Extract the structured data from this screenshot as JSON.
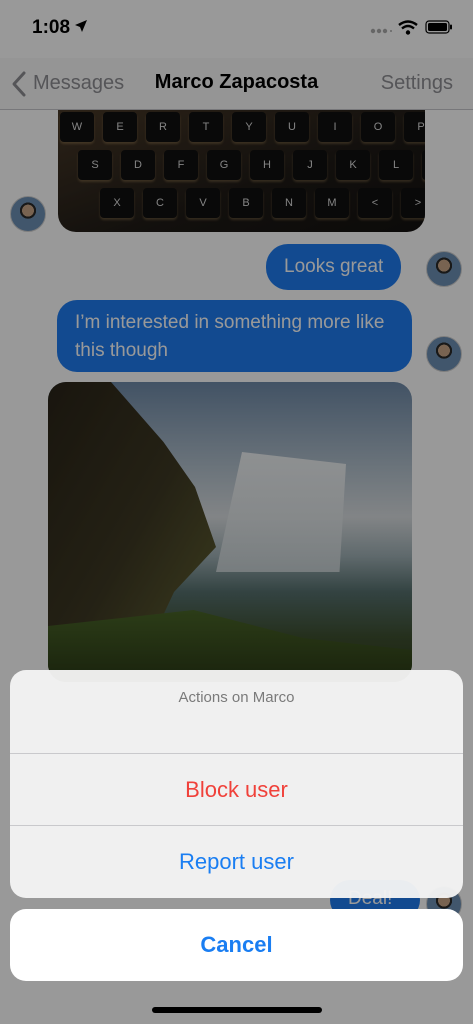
{
  "status_bar": {
    "time": "1:08"
  },
  "nav": {
    "back_label": "Messages",
    "title": "Marco Zapacosta",
    "right_label": "Settings"
  },
  "keyboard": {
    "rows": [
      [
        "W",
        "E",
        "R",
        "T",
        "Y",
        "U",
        "I",
        "O",
        "P",
        "{"
      ],
      [
        "S",
        "D",
        "F",
        "G",
        "H",
        "J",
        "K",
        "L",
        ";"
      ],
      [
        "X",
        "C",
        "V",
        "B",
        "N",
        "M",
        "<",
        ">"
      ]
    ]
  },
  "messages": [
    {
      "text": "Looks great",
      "sender": "me"
    },
    {
      "text": "I’m interested in something more like this though",
      "sender": "me"
    },
    {
      "text": "Deal!",
      "sender": "me"
    }
  ],
  "action_sheet": {
    "title": "Actions on Marco",
    "actions": [
      {
        "label": "Block user",
        "style": "destructive",
        "color": "#f0413a"
      },
      {
        "label": "Report user",
        "style": "default",
        "color": "#1a7ef2"
      }
    ],
    "cancel_label": "Cancel"
  },
  "colors": {
    "bubble": "#1e7cf0",
    "accent": "#1a7ef2",
    "destructive": "#f0413a"
  }
}
